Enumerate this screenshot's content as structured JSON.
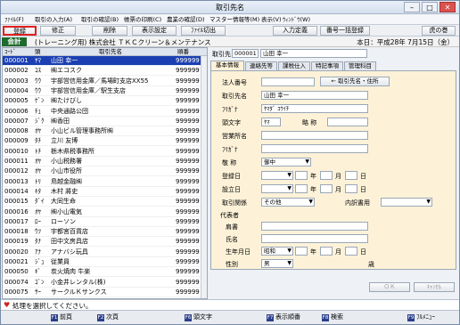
{
  "window": {
    "title": "取引先名"
  },
  "menu": [
    "ﾌｧｲﾙ(F)",
    "取引の入力(A)",
    "取引の確認(B)",
    "帳票の印刷(C)",
    "農業の確認(D)",
    "マスター情報等(M)",
    "表示(V)",
    "ｳｨﾝﾄﾞｳ(W)"
  ],
  "toolbar": {
    "register": "登録",
    "modify": "修正",
    "delete": "削除",
    "display_settings": "表示設定",
    "file_output": "ﾌｧｲﾙ切出",
    "input_definition": "入力定義",
    "number_batch": "番号一括登録",
    "tiger_roll": "虎の巻"
  },
  "company": {
    "badge": "会計",
    "name": "(トレーニング用) 株式会社 ＴＫＣクリーン＆メンテナンス",
    "date": "本日：平成28年 7月15日（金）"
  },
  "list": {
    "headers": {
      "code": "ｺｰﾄﾞ",
      "head": "頭",
      "name": "取引先名",
      "order": "順番"
    },
    "rows": [
      {
        "code": "000001",
        "head": "ﾔﾏ",
        "name": "山田 幸一",
        "order": "999999"
      },
      {
        "code": "000002",
        "head": "ｺｽ",
        "name": "㈱エコスク",
        "order": "999999"
      },
      {
        "code": "000003",
        "head": "ｳｳ",
        "name": "宇部営信用金庫／馬場町支店XX55",
        "order": "999999"
      },
      {
        "code": "000004",
        "head": "ｳｳ",
        "name": "宇部営信用金庫／駅生支店",
        "order": "999999"
      },
      {
        "code": "000005",
        "head": "ｹﾞﾝ",
        "name": "㈱たけびし",
        "order": "999999"
      },
      {
        "code": "000006",
        "head": "ﾁｭ",
        "name": "中央通路公団",
        "order": "999999"
      },
      {
        "code": "000007",
        "head": "ｼﾞｸ",
        "name": "㈱香田",
        "order": "999999"
      },
      {
        "code": "000008",
        "head": "ｵﾔ",
        "name": "小山ビル管理事務所㈱",
        "order": "999999"
      },
      {
        "code": "000009",
        "head": "ﾀﾁ",
        "name": "立川 友博",
        "order": "999999"
      },
      {
        "code": "000010",
        "head": "ﾄﾁ",
        "name": "栃木県税事務所",
        "order": "999999"
      },
      {
        "code": "000011",
        "head": "ｵﾔ",
        "name": "小山税務署",
        "order": "999999"
      },
      {
        "code": "000012",
        "head": "ｵﾔ",
        "name": "小山市役所",
        "order": "999999"
      },
      {
        "code": "000013",
        "head": "ﾄﾘ",
        "name": "鳥越金融㈱",
        "order": "999999"
      },
      {
        "code": "000014",
        "head": "ｷﾀ",
        "name": "木村 將史",
        "order": "999999"
      },
      {
        "code": "000015",
        "head": "ﾀﾞｲ",
        "name": "大同生命",
        "order": "999999"
      },
      {
        "code": "000016",
        "head": "ｵﾔ",
        "name": "㈱小山電気",
        "order": "999999"
      },
      {
        "code": "000017",
        "head": "ﾛｰ",
        "name": "ローソン",
        "order": "999999"
      },
      {
        "code": "000018",
        "head": "ｳﾂ",
        "name": "宇都宮百貨店",
        "order": "999999"
      },
      {
        "code": "000019",
        "head": "ﾀﾅ",
        "name": "田中文房具店",
        "order": "999999"
      },
      {
        "code": "000020",
        "head": "ｱﾅ",
        "name": "アナバシ玩具",
        "order": "999999"
      },
      {
        "code": "000021",
        "head": "ｼﾞｭ",
        "name": "従業員",
        "order": "999999"
      },
      {
        "code": "000050",
        "head": "ｷﾞ",
        "name": "炭火焼肉 牛楽",
        "order": "999999"
      },
      {
        "code": "000074",
        "head": "ｺﾞﾝ",
        "name": "小金井レンタル(株)",
        "order": "999999"
      },
      {
        "code": "000075",
        "head": "ｻｰ",
        "name": "サークルＫサンクス",
        "order": "999999"
      }
    ]
  },
  "right": {
    "code_label": "取引先",
    "code": "000001",
    "name": "山田 幸一",
    "tabs": [
      "基本情報",
      "連絡先等",
      "課税仕入",
      "特記事項",
      "管理科目"
    ],
    "form": {
      "corp_no_label": "法人番号",
      "name_label": "取引先名",
      "name_value": "山田 幸一",
      "kana_label": "ﾌﾘｶﾞﾅ",
      "kana_value": "ﾔﾏﾀﾞ ｺｳｲﾁ",
      "head_label": "頭文字",
      "head_value": "ﾔﾏ",
      "abbr_label": "略 称",
      "office_label": "営業所名",
      "office_kana_label": "ﾌﾘｶﾞﾅ",
      "honor_label": "敬 称",
      "honor_value": "御中",
      "reg_date_label": "登録日",
      "est_date_label": "設立日",
      "year": "年",
      "month": "月",
      "day": "日",
      "relation_label": "取引関係",
      "relation_value": "その他",
      "detail_label": "内訳書用",
      "rep_header": "代表者",
      "title_label": "肩書",
      "person_name_label": "氏名",
      "birth_label": "生年月日",
      "era_value": "昭和",
      "gender_label": "性別",
      "gender_value": "男",
      "age": "歳"
    },
    "btn_arrow": "← 取引先名・住所",
    "ok": "ＯＫ",
    "cancel": "ｷｬﾝｾﾙ"
  },
  "status": "処理を選択してください。",
  "fkeys": [
    {
      "key": "F1",
      "label": "前頁"
    },
    {
      "key": "F2",
      "label": "次頁"
    },
    {
      "key": "F6",
      "label": "頭文字"
    },
    {
      "key": "F7",
      "label": "表示順番"
    },
    {
      "key": "F8",
      "label": "検索"
    },
    {
      "key": "F9",
      "label": "ﾌﾙﾒﾆｭｰ"
    }
  ]
}
